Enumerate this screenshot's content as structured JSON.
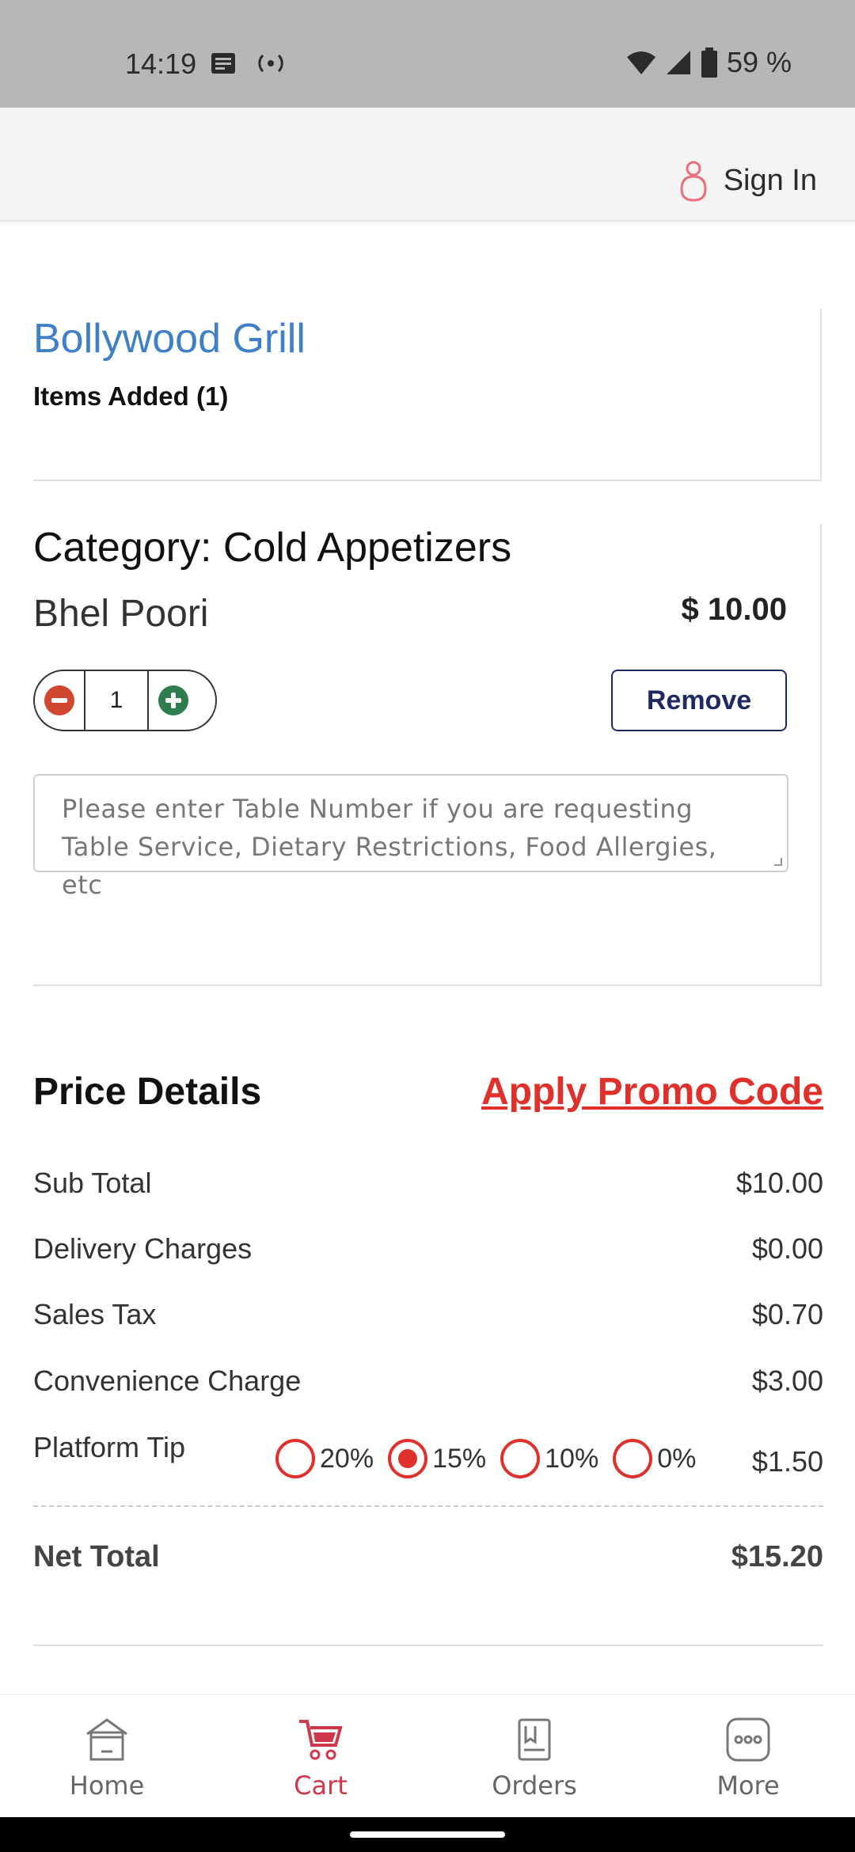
{
  "status_bar": {
    "time": "14:19",
    "battery": "59 %",
    "icons": [
      "notification-icon",
      "hotspot-icon",
      "wifi-icon",
      "signal-icon",
      "battery-icon"
    ]
  },
  "header": {
    "signin_label": "Sign In"
  },
  "restaurant": {
    "name": "Bollywood Grill",
    "items_added": "Items Added (1)"
  },
  "cart_item": {
    "category": "Category: Cold Appetizers",
    "name": "Bhel Poori",
    "price": "$ 10.00",
    "quantity": "1",
    "remove_label": "Remove",
    "notes_placeholder": "Please enter Table Number if you are requesting Table Service, Dietary Restrictions, Food Allergies, etc"
  },
  "price_details": {
    "title": "Price Details",
    "promo_label": "Apply Promo Code",
    "rows": [
      {
        "label": "Sub Total",
        "value": "$10.00"
      },
      {
        "label": "Delivery Charges",
        "value": "$0.00"
      },
      {
        "label": "Sales Tax",
        "value": "$0.70"
      },
      {
        "label": "Convenience Charge",
        "value": "$3.00"
      }
    ],
    "tip": {
      "label": "Platform Tip",
      "options": [
        "20%",
        "15%",
        "10%",
        "0%"
      ],
      "selected": "15%",
      "value": "$1.50"
    },
    "net_total_label": "Net Total",
    "net_total_value": "$15.20"
  },
  "bottom_nav": {
    "items": [
      {
        "label": "Home",
        "icon": "home-icon"
      },
      {
        "label": "Cart",
        "icon": "cart-icon",
        "active": true
      },
      {
        "label": "Orders",
        "icon": "orders-icon"
      },
      {
        "label": "More",
        "icon": "more-icon"
      }
    ]
  },
  "colors": {
    "accent_red": "#e0302b",
    "brand_blue": "#3f7fc6",
    "remove_navy": "#1f2a63",
    "cart_active": "#d0364a",
    "plus_green": "#2e7d4f"
  }
}
